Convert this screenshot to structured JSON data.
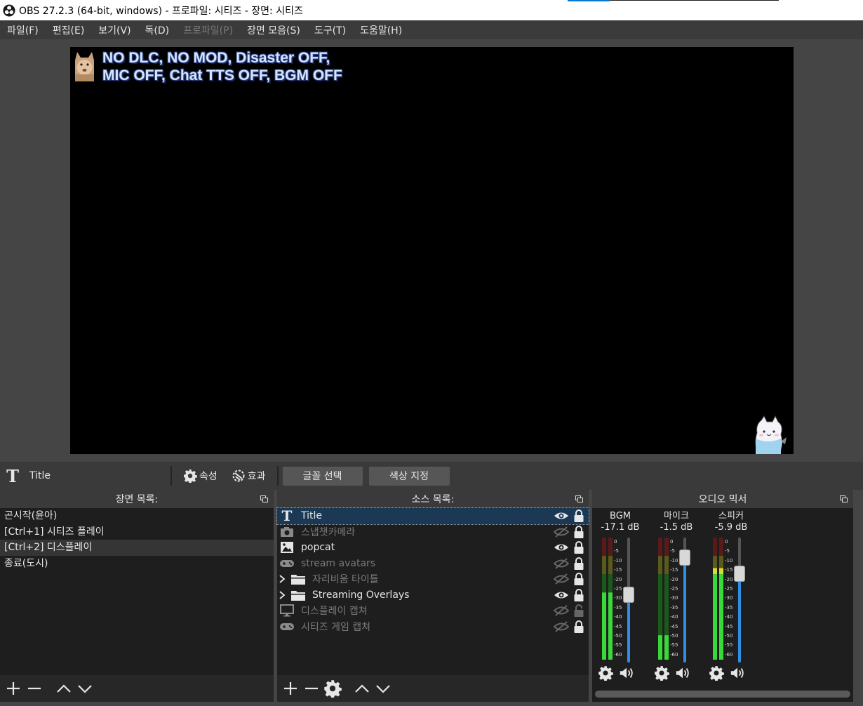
{
  "window": {
    "title": "OBS 27.2.3 (64-bit, windows) - 프로파일: 시티즈 - 장면: 시티즈"
  },
  "menu": {
    "items": [
      {
        "label": "파일(F)",
        "disabled": false
      },
      {
        "label": "편집(E)",
        "disabled": false
      },
      {
        "label": "보기(V)",
        "disabled": false
      },
      {
        "label": "독(D)",
        "disabled": false
      },
      {
        "label": "프로파일(P)",
        "disabled": true
      },
      {
        "label": "장면 모음(S)",
        "disabled": false
      },
      {
        "label": "도구(T)",
        "disabled": false
      },
      {
        "label": "도움말(H)",
        "disabled": false
      }
    ]
  },
  "preview": {
    "overlay_text": "NO DLC, NO MOD, Disaster OFF,\nMIC OFF, Chat TTS OFF, BGM OFF"
  },
  "context_bar": {
    "source_icon": "text-source-icon",
    "source_name": "Title",
    "properties_label": "속성",
    "filters_label": "효과",
    "select_font_label": "글꼴 선택",
    "select_color_label": "색상 지정"
  },
  "scenes": {
    "header": "장면 목록:",
    "items": [
      {
        "label": "곤시작(윤아)",
        "selected": false
      },
      {
        "label": "[Ctrl+1] 시티즈 플레이",
        "selected": false
      },
      {
        "label": "[Ctrl+2] 디스플레이",
        "selected": true
      },
      {
        "label": "종료(도시)",
        "selected": false
      }
    ]
  },
  "sources": {
    "header": "소스 목록:",
    "items": [
      {
        "label": "Title",
        "icon": "text-icon",
        "visible": true,
        "locked": true,
        "selected": true,
        "group": false
      },
      {
        "label": "스냅챗카메라",
        "icon": "camera-icon",
        "visible": false,
        "locked": true,
        "selected": false,
        "group": false
      },
      {
        "label": "popcat",
        "icon": "image-icon",
        "visible": true,
        "locked": true,
        "selected": false,
        "group": false
      },
      {
        "label": "stream avatars",
        "icon": "gamepad-icon",
        "visible": false,
        "locked": true,
        "selected": false,
        "group": false
      },
      {
        "label": "자리비움 타이틀",
        "icon": "folder-icon",
        "visible": false,
        "locked": true,
        "selected": false,
        "group": true
      },
      {
        "label": "Streaming Overlays",
        "icon": "folder-icon",
        "visible": true,
        "locked": true,
        "selected": false,
        "group": true
      },
      {
        "label": "디스플레이 캡쳐",
        "icon": "monitor-icon",
        "visible": false,
        "locked": false,
        "selected": false,
        "group": false
      },
      {
        "label": "시티즈 게임 캡쳐",
        "icon": "gamepad-icon",
        "visible": false,
        "locked": true,
        "selected": false,
        "group": false
      }
    ]
  },
  "mixer": {
    "header": "오디오 믹서",
    "scale_labels": [
      "0",
      "-5",
      "-10",
      "-15",
      "-20",
      "-25",
      "-30",
      "-35",
      "-40",
      "-45",
      "-50",
      "-55",
      "-60"
    ],
    "channels": [
      {
        "name": "BGM",
        "db": "-17.1 dB",
        "level": 0.55,
        "fader": 0.55
      },
      {
        "name": "마이크",
        "db": "-1.5 dB",
        "level": 0.2,
        "fader": 0.89
      },
      {
        "name": "스피커",
        "db": "-5.9 dB",
        "level": 0.75,
        "fader": 0.74
      }
    ]
  }
}
